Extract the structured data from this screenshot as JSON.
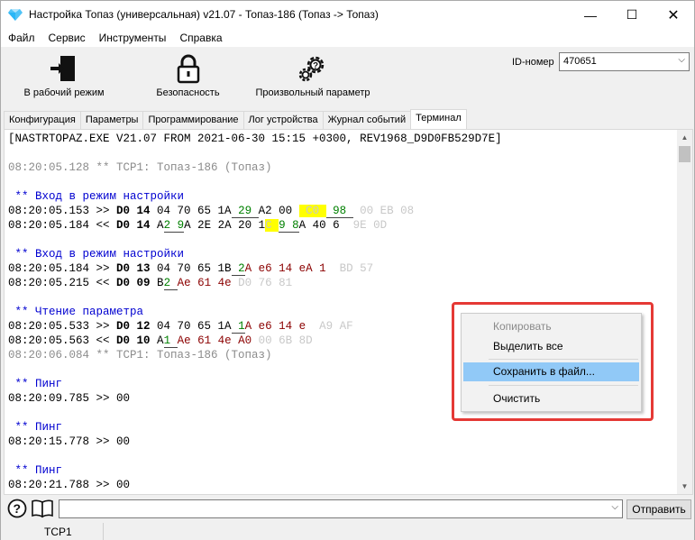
{
  "window": {
    "title": "Настройка Топаз (универсальная) v21.07 - Топаз-186 (Топаз -> Топаз)",
    "min_glyph": "—",
    "max_glyph": "☐",
    "close_glyph": "✕"
  },
  "menu": [
    "Файл",
    "Сервис",
    "Инструменты",
    "Справка"
  ],
  "toolbar": {
    "work_mode": "В рабочий режим",
    "security": "Безопасность",
    "param": "Произвольный параметр",
    "id_label": "ID-номер",
    "id_value": "470651"
  },
  "tabs": [
    "Конфигурация",
    "Параметры",
    "Программирование",
    "Лог устройства",
    "Журнал событий",
    "Терминал"
  ],
  "terminal": {
    "header": "[NASTRTOPAZ.EXE V21.07 FROM 2021-06-30 15:15 +0300, REV1968_D9D0FB529D7E]",
    "tcp1": "08:20:05.128 ** TCP1: Топаз-186 (Топаз)",
    "sec1": " ** Вход в режим настройки",
    "l1_ts": "08:20:05.153 >> ",
    "l1_a": "D0 14",
    "l1_b": " 04 70 65 1A",
    "l1_c": " 29 ",
    "l1_d": "A2 00 ",
    "l1_e": " C0 ",
    "l1_f": " 98 ",
    "l1_g": " 00 EB 08",
    "l2_ts": "08:20:05.184 << ",
    "l2_a": "D0 14",
    "l2_b": " A",
    "l2_c": "2 9",
    "l2_d": "A 2E 2A 20 1",
    "l2_e": "C ",
    "l2_f": "9 8",
    "l2_g": "A 40 6",
    "l2_h": "  9E 0D",
    "sec2": " ** Вход в режим настройки",
    "l3_ts": "08:20:05.184 >> ",
    "l3_a": "D0 13",
    "l3_b": " 04 70 65 1B",
    "l3_c": " 2",
    "l3_d": "A e6 14 eA 1",
    "l3_e": "  BD 57",
    "l4_ts": "08:20:05.215 << ",
    "l4_a": "D0 09",
    "l4_b": " B",
    "l4_c": "2 ",
    "l4_d": "Ae 61 4e",
    "l4_e": " D0 76 81",
    "sec3": " ** Чтение параметра",
    "l5_ts": "08:20:05.533 >> ",
    "l5_a": "D0 12",
    "l5_b": " 04 70 65 1A",
    "l5_c": " 1",
    "l5_d": "A e6 14 e",
    "l5_e": "  A9 AF",
    "l6_ts": "08:20:05.563 << ",
    "l6_a": "D0 10",
    "l6_b": " A",
    "l6_c": "1 ",
    "l6_d": "Ae 61 4e A0",
    "l6_e": " 00 6B 8D",
    "tcp2": "08:20:06.084 ** TCP1: Топаз-186 (Топаз)",
    "ping_title": " ** Пинг",
    "ping1": "08:20:09.785 >> 00",
    "ping2": "08:20:15.778 >> 00",
    "ping3": "08:20:21.788 >> 00"
  },
  "context_menu": {
    "copy": "Копировать",
    "select_all": "Выделить все",
    "save": "Сохранить в файл...",
    "clear": "Очистить"
  },
  "bottom": {
    "send": "Отправить",
    "status": "TCP1"
  }
}
